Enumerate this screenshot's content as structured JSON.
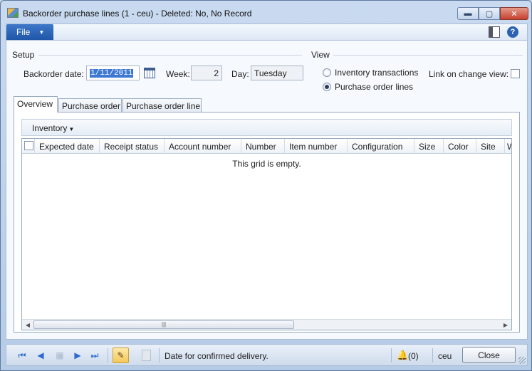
{
  "window": {
    "title": "Backorder purchase lines (1 - ceu) - Deleted: No, No Record",
    "min_glyph": "▬",
    "max_glyph": "▢",
    "close_glyph": "✕"
  },
  "ribbon": {
    "file_label": "File",
    "icons": [
      "layout-icon",
      "help-icon"
    ]
  },
  "setup": {
    "title": "Setup",
    "backorder_date_label": "Backorder date:",
    "backorder_date_value": "1/11/2011",
    "week_label": "Week:",
    "week_value": "2",
    "day_label": "Day:",
    "day_value": "Tuesday"
  },
  "view": {
    "title": "View",
    "options": [
      {
        "label": "Inventory transactions",
        "selected": false
      },
      {
        "label": "Purchase order lines",
        "selected": true
      }
    ],
    "link_label": "Link on change view:",
    "link_checked": false
  },
  "tabs": [
    "Overview",
    "Purchase order",
    "Purchase order line"
  ],
  "grid": {
    "menu_label": "Inventory",
    "columns": [
      "Expected date",
      "Receipt status",
      "Account number",
      "Number",
      "Item number",
      "Configuration",
      "Size",
      "Color",
      "Site",
      "W"
    ],
    "empty_text": "This grid is empty."
  },
  "statusbar": {
    "status_text": "Date for confirmed delivery.",
    "notifications": "(0)",
    "company": "ceu",
    "close_label": "Close"
  },
  "colors": {
    "accent": "#2d6ad1",
    "file_button": "#2b62b3",
    "close_window": "#c7402d"
  }
}
